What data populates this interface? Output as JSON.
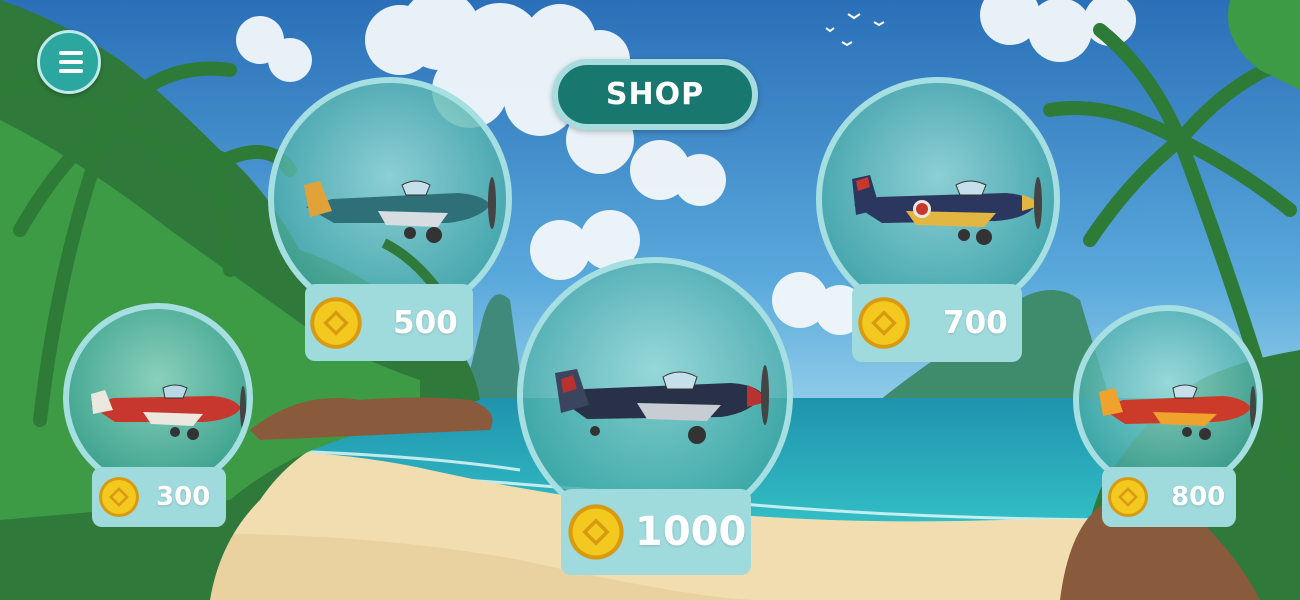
{
  "header": {
    "title": "SHOP"
  },
  "menu": {
    "icon": "hamburger-menu-icon"
  },
  "shop_items": [
    {
      "id": "red-white-plane",
      "price": "300",
      "plane_colors": {
        "body": "#c8372e",
        "trim": "#ece8e0"
      },
      "currency_icon": "gold-coin-icon"
    },
    {
      "id": "teal-plane",
      "price": "500",
      "plane_colors": {
        "body": "#2f6f78",
        "trim": "#e2a23a"
      },
      "currency_icon": "gold-coin-icon"
    },
    {
      "id": "navy-red-plane",
      "price": "1000",
      "plane_colors": {
        "body": "#283148",
        "trim": "#b83232"
      },
      "currency_icon": "gold-coin-icon"
    },
    {
      "id": "navy-yellow-plane",
      "price": "700",
      "plane_colors": {
        "body": "#2c3760",
        "trim": "#e3b641"
      },
      "currency_icon": "gold-coin-icon"
    },
    {
      "id": "red-orange-plane",
      "price": "800",
      "plane_colors": {
        "body": "#cc3a2a",
        "trim": "#f0a32c"
      },
      "currency_icon": "gold-coin-icon"
    }
  ],
  "colors": {
    "accent": "#18786f",
    "panel": "#9fdadd",
    "coin": "#f0c21b",
    "sky": "#2f7ec4",
    "sea": "#1da5b8",
    "sand": "#f1ddb0"
  }
}
